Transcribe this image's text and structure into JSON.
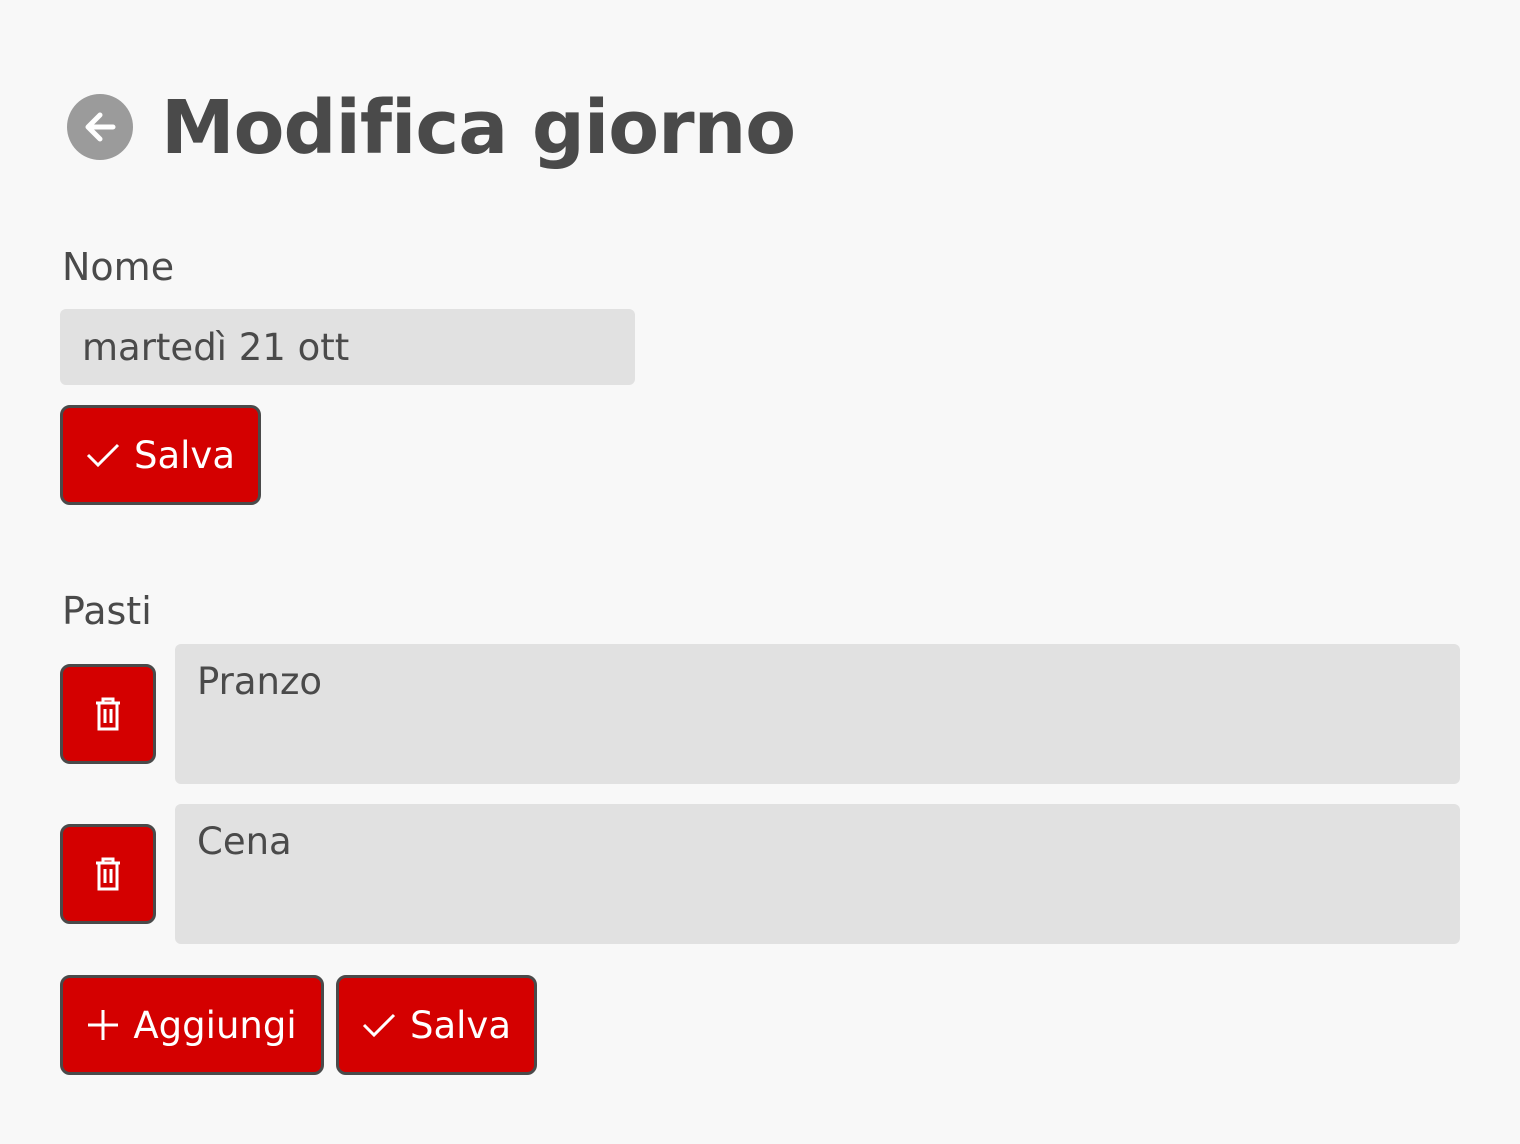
{
  "header": {
    "title": "Modifica giorno",
    "back_icon": "arrow-left-circle-icon"
  },
  "name_section": {
    "label": "Nome",
    "input_value": "martedì 21 ott",
    "save_label": "Salva",
    "save_icon": "check-icon"
  },
  "meals_section": {
    "label": "Pasti",
    "meals": [
      {
        "value": "Pranzo",
        "delete_icon": "trash-icon"
      },
      {
        "value": "Cena",
        "delete_icon": "trash-icon"
      }
    ],
    "add_label": "Aggiungi",
    "add_icon": "plus-icon",
    "save_label": "Salva",
    "save_icon": "check-icon"
  },
  "colors": {
    "accent": "#d40000",
    "text": "#4a4a4a",
    "input_bg": "#e1e1e1",
    "page_bg": "#f8f8f8",
    "back_button": "#9b9b9b"
  }
}
